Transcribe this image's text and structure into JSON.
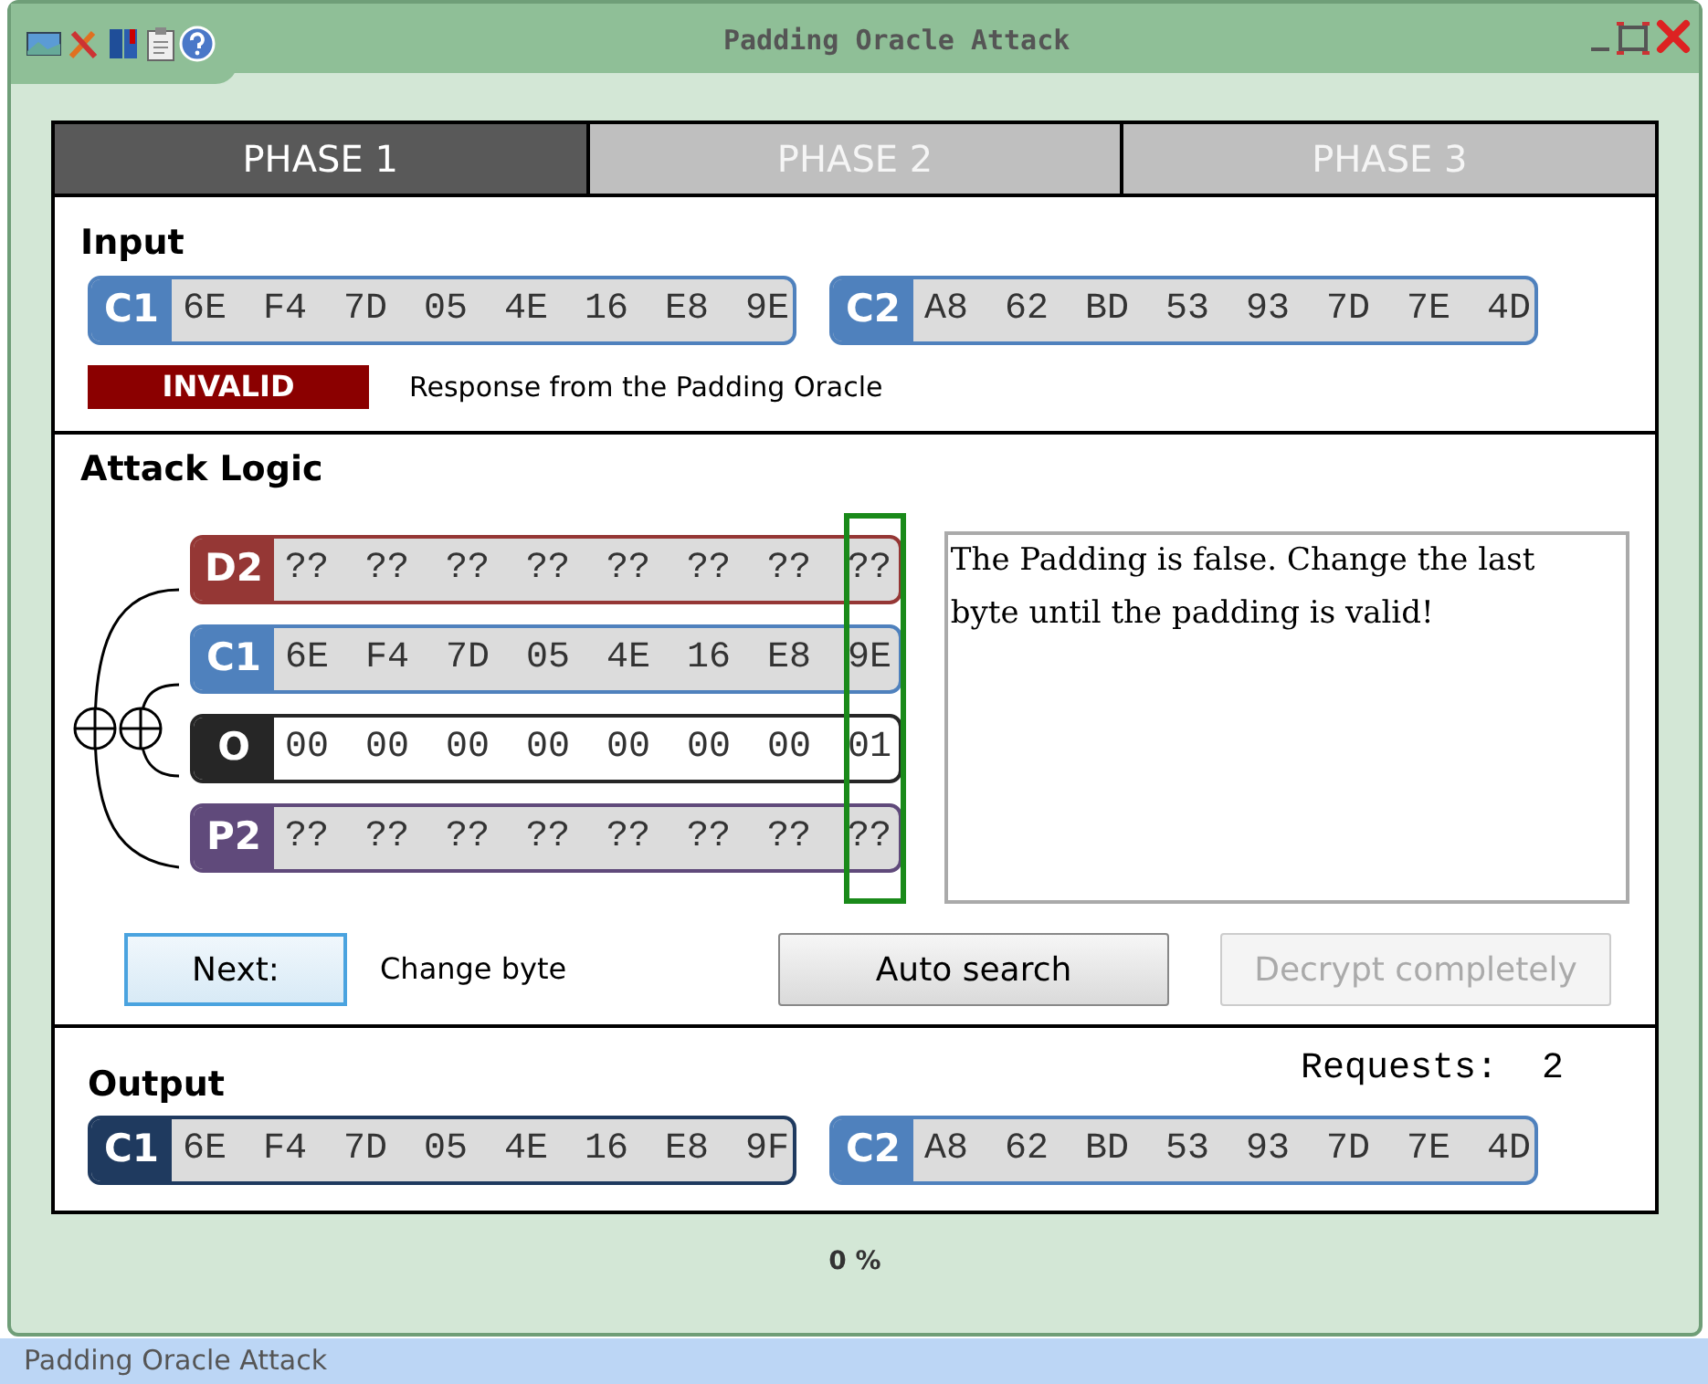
{
  "window": {
    "title": "Padding Oracle Attack"
  },
  "tabs": [
    {
      "label": "PHASE 1",
      "selected": true
    },
    {
      "label": "PHASE 2",
      "selected": false
    },
    {
      "label": "PHASE 3",
      "selected": false
    }
  ],
  "input": {
    "title": "Input",
    "blocks": [
      {
        "label": "C1",
        "color": "#4f81bd",
        "value": "6E F4 7D 05 4E 16 E8 9E"
      },
      {
        "label": "C2",
        "color": "#4f81bd",
        "value": "A8 62 BD 53 93 7D 7E 4D"
      }
    ],
    "oracle": {
      "text": "INVALID",
      "valid": false
    },
    "caption": "Response from the Padding Oracle"
  },
  "attack_logic": {
    "title": "Attack Logic",
    "rows": [
      {
        "label": "D2",
        "color": "#953735",
        "filled": true,
        "value": "?? ?? ?? ?? ?? ?? ?? ??"
      },
      {
        "label": "C1",
        "color": "#4f81bd",
        "filled": true,
        "value": "6E F4 7D 05 4E 16 E8 9E"
      },
      {
        "label": "O",
        "color": "#262626",
        "filled": false,
        "value": "00 00 00 00 00 00 00 01"
      },
      {
        "label": "P2",
        "color": "#604a7b",
        "filled": true,
        "value": "?? ?? ?? ?? ?? ?? ?? ??"
      }
    ],
    "message": "The Padding is false. Change the last byte until the padding is valid!",
    "next_button": {
      "label": "Next:",
      "focused": true
    },
    "next_caption": "Change byte",
    "buttons": [
      {
        "label": "Auto search",
        "disabled": false
      },
      {
        "label": "Decrypt completely",
        "disabled": true
      }
    ]
  },
  "output": {
    "title": "Output",
    "requests": "Requests:  2",
    "blocks": [
      {
        "label": "C1",
        "color": "#1f3a5f",
        "value": "6E F4 7D 05 4E 16 E8 9F"
      },
      {
        "label": "C2",
        "color": "#4f81bd",
        "value": "A8 62 BD 53 93 7D 7E 4D"
      }
    ]
  },
  "progress": "0 %",
  "status_bar": "Padding Oracle Attack"
}
